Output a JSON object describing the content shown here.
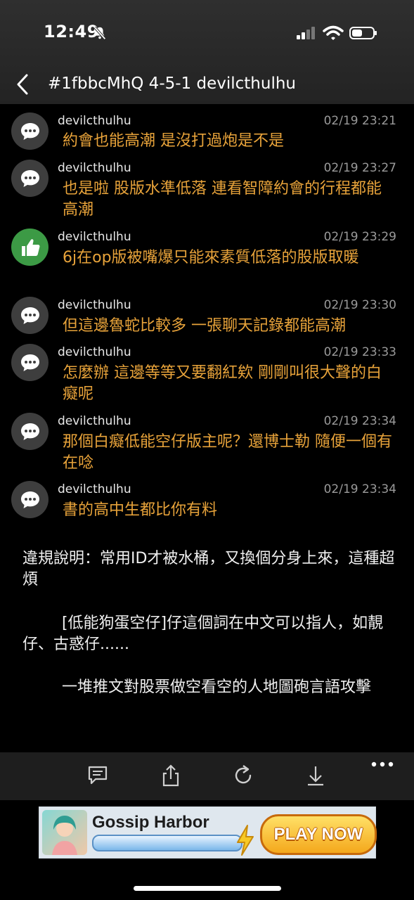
{
  "status_bar": {
    "time": "12:49"
  },
  "header": {
    "title": "#1fbbcMhQ 4-5-1 devilcthulhu"
  },
  "messages": [
    {
      "author": "devilcthulhu",
      "time": "02/19 23:21",
      "icon": "comment-icon",
      "text": "約會也能高潮 是沒打過炮是不是"
    },
    {
      "author": "devilcthulhu",
      "time": "02/19 23:27",
      "icon": "comment-icon",
      "text": "也是啦 股版水準低落 連看智障約會的行程都能高潮"
    },
    {
      "author": "devilcthulhu",
      "time": "02/19 23:29",
      "icon": "thumbs-up-icon",
      "text": "6j在op版被嘴爆只能來素質低落的股版取暖"
    },
    {
      "author": "devilcthulhu",
      "time": "02/19 23:30",
      "icon": "comment-icon",
      "text": "但這邊魯蛇比較多 一張聊天記錄都能高潮"
    },
    {
      "author": "devilcthulhu",
      "time": "02/19 23:33",
      "icon": "comment-icon",
      "text": "怎麼辦 這邊等等又要翻紅欸 剛剛叫很大聲的白癡呢"
    },
    {
      "author": "devilcthulhu",
      "time": "02/19 23:34",
      "icon": "comment-icon",
      "text": "那個白癡低能空仔版主呢？還博士勒 隨便一個有在唸"
    },
    {
      "author": "devilcthulhu",
      "time": "02/19 23:34",
      "icon": "comment-icon",
      "text": "書的高中生都比你有料"
    }
  ],
  "notes": [
    "違規說明：常用ID才被水桶，又換個分身上來，這種超煩",
    "        [低能狗蛋空仔]仔這個詞在中文可以指人，如靚仔、古惑仔......",
    "        一堆推文對股票做空看空的人地圖砲言語攻擊"
  ],
  "toolbar": {
    "icons": [
      "comment-icon",
      "share-icon",
      "refresh-icon",
      "download-icon",
      "more-icon"
    ]
  },
  "ad": {
    "title": "Gossip Harbor",
    "cta": "PLAY NOW"
  },
  "colors": {
    "push_text": "#e8a33a",
    "avatar_green": "#3c9a45"
  }
}
